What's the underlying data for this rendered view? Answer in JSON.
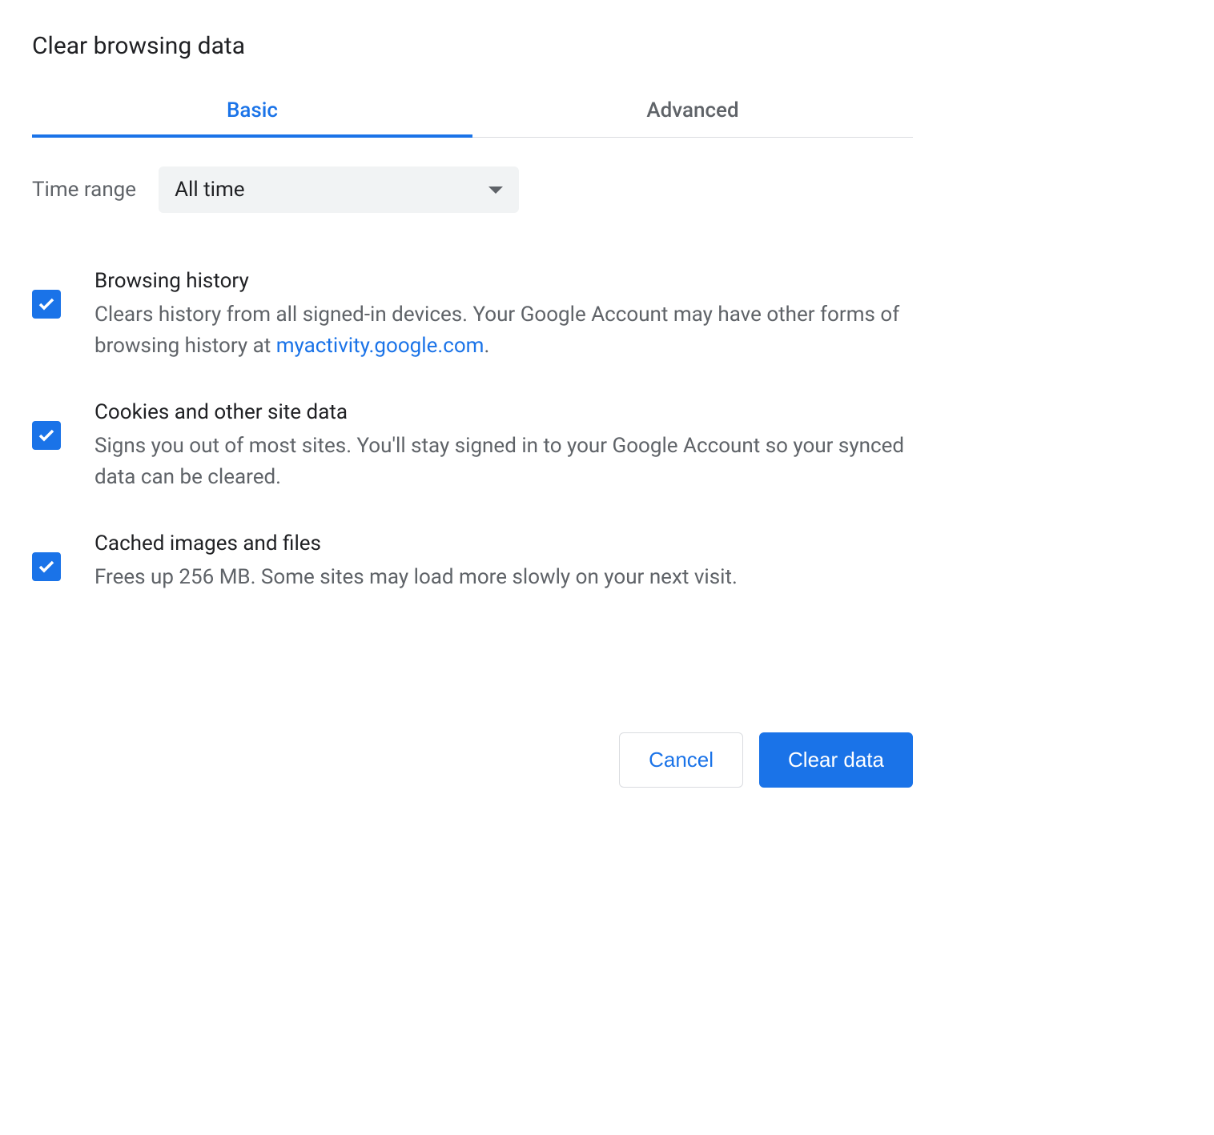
{
  "dialog": {
    "title": "Clear browsing data"
  },
  "tabs": {
    "basic": "Basic",
    "advanced": "Advanced"
  },
  "time_range": {
    "label": "Time range",
    "selected": "All time"
  },
  "options": [
    {
      "title": "Browsing history",
      "desc_pre": "Clears history from all signed-in devices. Your Google Account may have other forms of browsing history at ",
      "link": "myactivity.google.com",
      "desc_post": ".",
      "checked": true
    },
    {
      "title": "Cookies and other site data",
      "desc": "Signs you out of most sites. You'll stay signed in to your Google Account so your synced data can be cleared.",
      "checked": true
    },
    {
      "title": "Cached images and files",
      "desc": "Frees up 256 MB. Some sites may load more slowly on your next visit.",
      "checked": true
    }
  ],
  "buttons": {
    "cancel": "Cancel",
    "clear": "Clear data"
  }
}
